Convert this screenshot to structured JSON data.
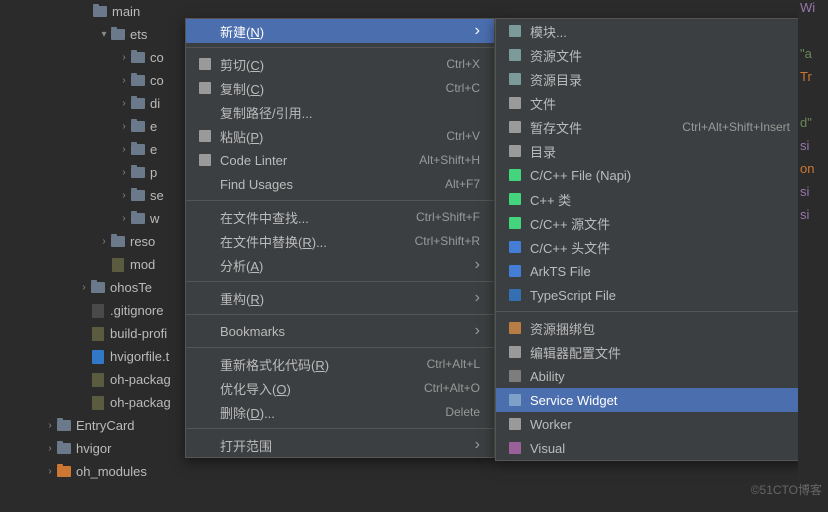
{
  "tree": [
    {
      "indent": 80,
      "arrow": "",
      "icon": "folder",
      "label": "main"
    },
    {
      "indent": 98,
      "arrow": "▾",
      "icon": "folder",
      "label": "ets"
    },
    {
      "indent": 118,
      "arrow": "›",
      "icon": "folder",
      "label": "co"
    },
    {
      "indent": 118,
      "arrow": "›",
      "icon": "folder",
      "label": "co"
    },
    {
      "indent": 118,
      "arrow": "›",
      "icon": "folder",
      "label": "di"
    },
    {
      "indent": 118,
      "arrow": "›",
      "icon": "folder",
      "label": "e"
    },
    {
      "indent": 118,
      "arrow": "›",
      "icon": "folder",
      "label": "e"
    },
    {
      "indent": 118,
      "arrow": "›",
      "icon": "folder",
      "label": "p"
    },
    {
      "indent": 118,
      "arrow": "›",
      "icon": "folder",
      "label": "se"
    },
    {
      "indent": 118,
      "arrow": "›",
      "icon": "folder",
      "label": "w"
    },
    {
      "indent": 98,
      "arrow": "›",
      "icon": "folder",
      "label": "reso"
    },
    {
      "indent": 98,
      "arrow": "",
      "icon": "json",
      "label": "mod"
    },
    {
      "indent": 78,
      "arrow": "›",
      "icon": "folder",
      "label": "ohosTe"
    },
    {
      "indent": 78,
      "arrow": "",
      "icon": "file",
      "label": ".gitignore"
    },
    {
      "indent": 78,
      "arrow": "",
      "icon": "json",
      "label": "build-profi"
    },
    {
      "indent": 78,
      "arrow": "",
      "icon": "ts",
      "label": "hvigorfile.t"
    },
    {
      "indent": 78,
      "arrow": "",
      "icon": "json",
      "label": "oh-packag"
    },
    {
      "indent": 78,
      "arrow": "",
      "icon": "json",
      "label": "oh-packag"
    },
    {
      "indent": 44,
      "arrow": "›",
      "icon": "folder",
      "label": "EntryCard"
    },
    {
      "indent": 44,
      "arrow": "›",
      "icon": "folder",
      "label": "hvigor"
    },
    {
      "indent": 44,
      "arrow": "›",
      "icon": "folder-orange",
      "label": "oh_modules"
    }
  ],
  "menu1": [
    {
      "type": "item",
      "icon": "",
      "label": "新建",
      "mn": "N",
      "arrow": true,
      "selected": true
    },
    {
      "type": "sep"
    },
    {
      "type": "item",
      "icon": "cut",
      "label": "剪切",
      "mn": "C",
      "shortcut": "Ctrl+X"
    },
    {
      "type": "item",
      "icon": "copy",
      "label": "复制",
      "mn": "C",
      "shortcut": "Ctrl+C"
    },
    {
      "type": "item",
      "icon": "",
      "label": "复制路径/引用..."
    },
    {
      "type": "item",
      "icon": "paste",
      "label": "粘贴",
      "mn": "P",
      "shortcut": "Ctrl+V"
    },
    {
      "type": "item",
      "icon": "lint",
      "label": "Code Linter",
      "shortcut": "Alt+Shift+H"
    },
    {
      "type": "item",
      "icon": "",
      "label": "Find Usages",
      "shortcut": "Alt+F7"
    },
    {
      "type": "sep"
    },
    {
      "type": "item",
      "icon": "",
      "label": "在文件中查找...",
      "shortcut": "Ctrl+Shift+F"
    },
    {
      "type": "item",
      "icon": "",
      "label": "在文件中替换",
      "mn": "R",
      "post": "...",
      "shortcut": "Ctrl+Shift+R"
    },
    {
      "type": "item",
      "icon": "",
      "label": "分析",
      "mn": "A",
      "arrow": true
    },
    {
      "type": "sep"
    },
    {
      "type": "item",
      "icon": "",
      "label": "重构",
      "mn": "R",
      "arrow": true
    },
    {
      "type": "sep"
    },
    {
      "type": "item",
      "icon": "",
      "label": "Bookmarks",
      "arrow": true
    },
    {
      "type": "sep"
    },
    {
      "type": "item",
      "icon": "",
      "label": "重新格式化代码",
      "mn": "R",
      "shortcut": "Ctrl+Alt+L"
    },
    {
      "type": "item",
      "icon": "",
      "label": "优化导入",
      "mn": "O",
      "shortcut": "Ctrl+Alt+O"
    },
    {
      "type": "item",
      "icon": "",
      "label": "删除",
      "mn": "D",
      "post": "...",
      "shortcut": "Delete"
    },
    {
      "type": "sep"
    },
    {
      "type": "item",
      "icon": "",
      "label": "打开范围",
      "arrow": true
    }
  ],
  "menu2": [
    {
      "type": "item",
      "icon": "module",
      "label": "模块..."
    },
    {
      "type": "item",
      "icon": "resfile",
      "label": "资源文件"
    },
    {
      "type": "item",
      "icon": "resdir",
      "label": "资源目录"
    },
    {
      "type": "item",
      "icon": "file",
      "label": "文件"
    },
    {
      "type": "item",
      "icon": "scratch",
      "label": "暂存文件",
      "shortcut": "Ctrl+Alt+Shift+Insert"
    },
    {
      "type": "item",
      "icon": "dir",
      "label": "目录"
    },
    {
      "type": "item",
      "icon": "c",
      "label": "C/C++ File (Napi)"
    },
    {
      "type": "item",
      "icon": "cpp",
      "label": "C++ 类"
    },
    {
      "type": "item",
      "icon": "c",
      "label": "C/C++ 源文件"
    },
    {
      "type": "item",
      "icon": "h",
      "label": "C/C++ 头文件"
    },
    {
      "type": "item",
      "icon": "ets",
      "label": "ArkTS File"
    },
    {
      "type": "item",
      "icon": "ts",
      "label": "TypeScript File"
    },
    {
      "type": "sep"
    },
    {
      "type": "item",
      "icon": "bundle",
      "label": "资源捆绑包"
    },
    {
      "type": "item",
      "icon": "gear",
      "label": "编辑器配置文件"
    },
    {
      "type": "item",
      "icon": "ability",
      "label": "Ability"
    },
    {
      "type": "item",
      "icon": "widget",
      "label": "Service Widget",
      "selected": true
    },
    {
      "type": "item",
      "icon": "worker",
      "label": "Worker"
    },
    {
      "type": "item",
      "icon": "visual",
      "label": "Visual"
    }
  ],
  "code": [
    "Wi",
    "",
    "\"a",
    "Tr",
    "",
    "d\"",
    "si",
    "on",
    "si",
    "si"
  ],
  "watermark": "©51CTO博客"
}
